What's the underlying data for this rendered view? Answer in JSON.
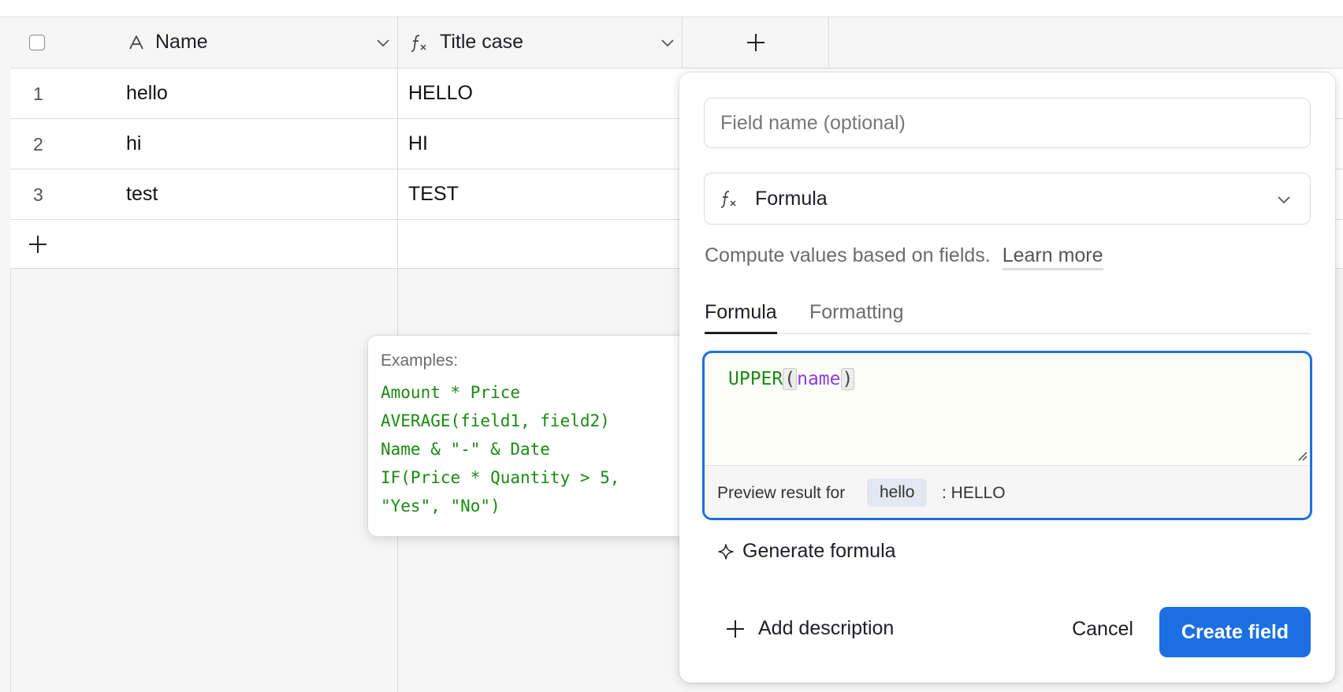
{
  "grid": {
    "columns": {
      "name": {
        "label": "Name",
        "icon": "text-field-icon"
      },
      "title_case": {
        "label": "Title case",
        "icon": "formula-icon"
      }
    },
    "rows": [
      {
        "num": "1",
        "name": "hello",
        "title_case": "HELLO"
      },
      {
        "num": "2",
        "name": "hi",
        "title_case": "HI"
      },
      {
        "num": "3",
        "name": "test",
        "title_case": "TEST"
      }
    ]
  },
  "tooltip": {
    "title": "Examples:",
    "lines": [
      "Amount * Price",
      "AVERAGE(field1, field2)",
      "Name & \"-\" & Date",
      "IF(Price * Quantity > 5,",
      "\"Yes\", \"No\")"
    ]
  },
  "panel": {
    "field_name_placeholder": "Field name (optional)",
    "type_label": "Formula",
    "description": "Compute values based on fields.",
    "learn_more": "Learn more",
    "tabs": {
      "formula": "Formula",
      "formatting": "Formatting"
    },
    "formula": {
      "fn": "UPPER",
      "open": "(",
      "field": "name",
      "close": ")"
    },
    "preview": {
      "label": "Preview result for",
      "sample": "hello",
      "result": ": HELLO"
    },
    "generate_label": "Generate formula",
    "add_description_label": "Add description",
    "cancel_label": "Cancel",
    "create_label": "Create field"
  },
  "colors": {
    "accent": "#1c6fe0",
    "formula_function": "#1a8a12",
    "formula_field": "#8a3ddc"
  }
}
